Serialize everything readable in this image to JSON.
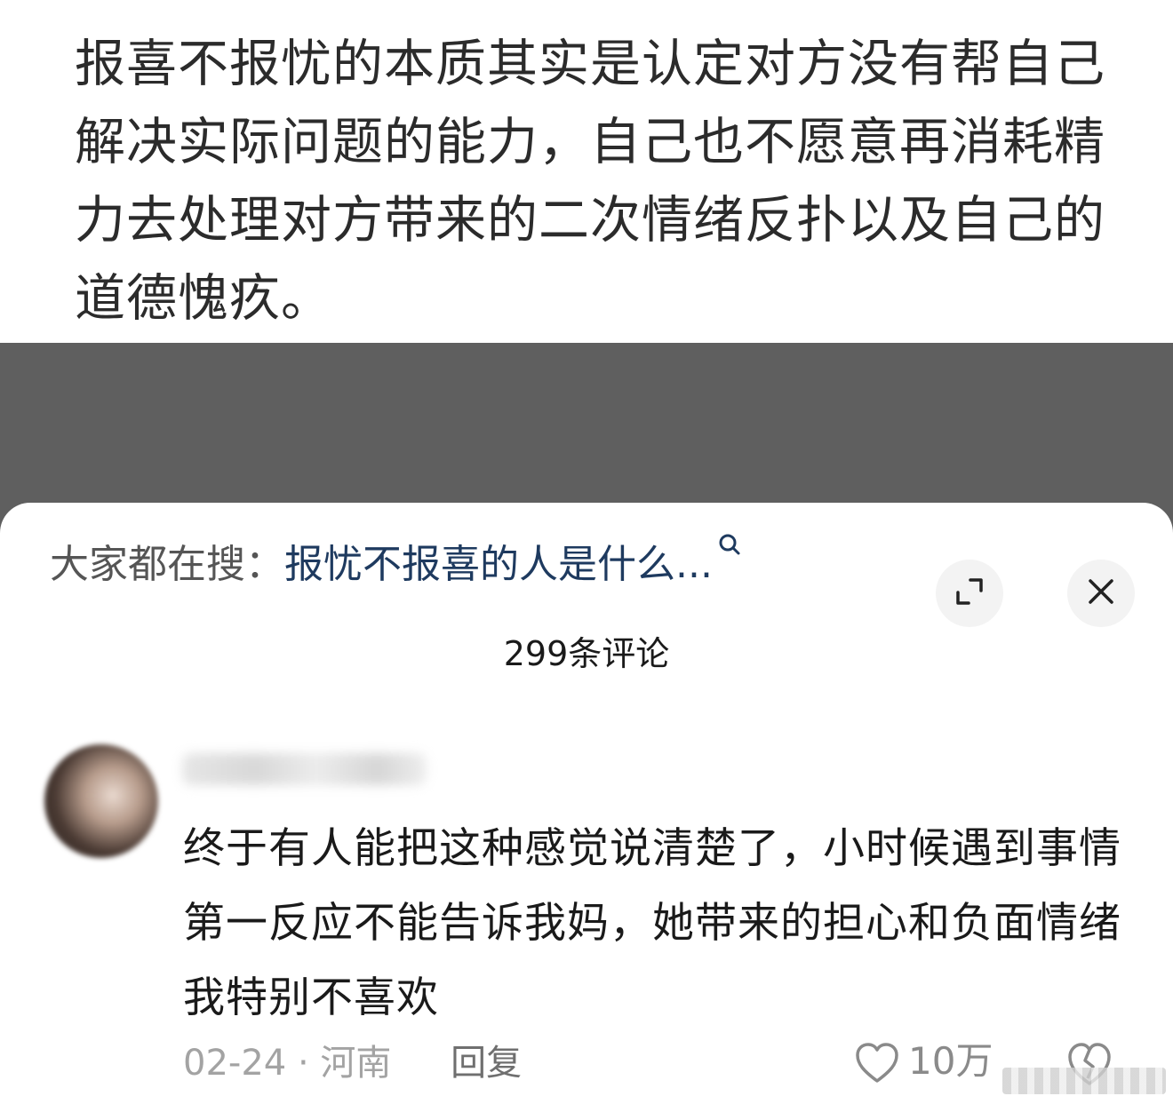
{
  "article": {
    "text": "报喜不报忧的本质其实是认定对方没有帮自己解决实际问题的能力，自己也不愿意再消耗精力去处理对方带来的二次情绪反扑以及自己的道德愧疚。"
  },
  "sheet": {
    "search_prefix": "大家都在搜：",
    "search_query": "报忧不报喜的人是什么...",
    "comment_count": "299条评论"
  },
  "comment": {
    "text": "终于有人能把这种感觉说清楚了，小时候遇到事情第一反应不能告诉我妈，她带来的担心和负面情绪我特别不喜欢",
    "date": "02-24",
    "separator": "·",
    "location": "河南",
    "reply_label": "回复",
    "like_count": "10万"
  },
  "icons": {
    "search": "search-icon",
    "expand": "expand-icon",
    "close": "close-icon",
    "like": "heart-icon",
    "dislike": "dislike-icon"
  },
  "colors": {
    "search_query": "#1e3a5f",
    "dim_overlay": "#5f5f5f"
  }
}
